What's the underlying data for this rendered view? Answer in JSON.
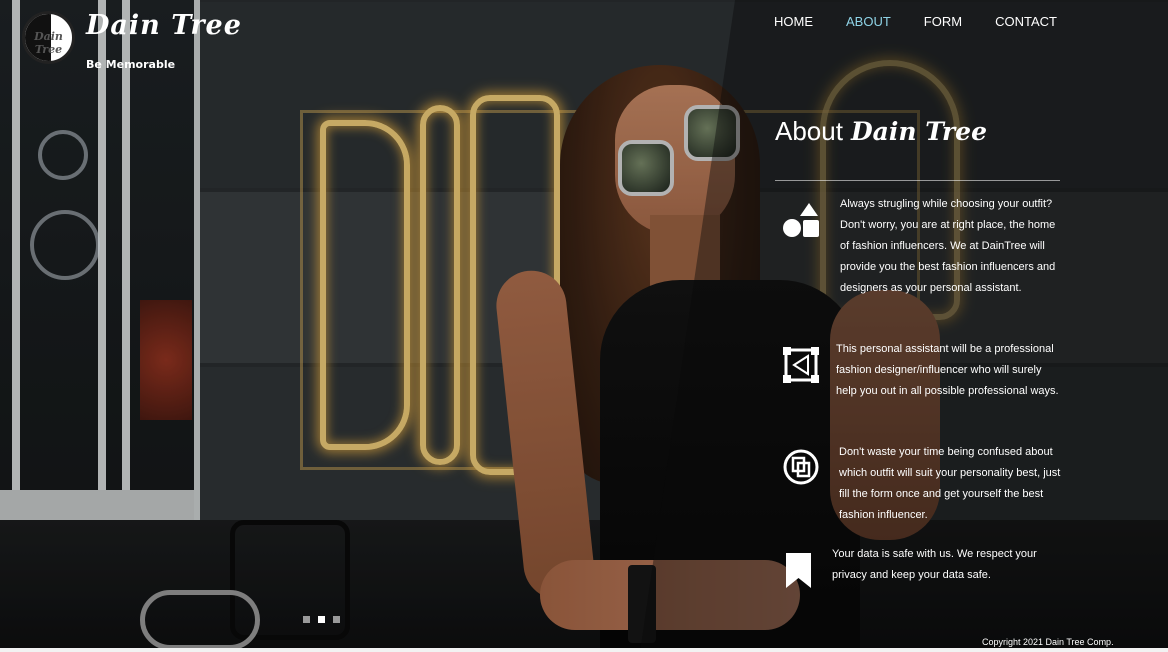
{
  "brand": {
    "name": "Dain Tree",
    "tagline": "Be Memorable",
    "logo_text": "Dain Tree"
  },
  "nav": {
    "items": [
      {
        "label": "HOME",
        "active": false
      },
      {
        "label": "ABOUT",
        "active": true
      },
      {
        "label": "FORM",
        "active": false
      },
      {
        "label": "CONTACT",
        "active": false
      }
    ],
    "active_color": "#8fd3e6"
  },
  "about": {
    "heading": "About",
    "heading_brand": "Dain Tree",
    "features": [
      {
        "icon": "shapes-icon",
        "text": "Always strugling while choosing your outfit? Don't worry, you are at right place, the home of fashion influencers. We at DainTree will provide you the best fashion influencers and designers as your personal assistant."
      },
      {
        "icon": "vector-nodes-icon",
        "text": "This personal assistant will be a professional fashion designer/influencer who will surely help you out in all possible professional ways."
      },
      {
        "icon": "copy-circle-icon",
        "text": "Don't waste your time being confused about which outfit will suit your personality best, just fill the form once and get yourself the best fashion influencer."
      },
      {
        "icon": "bookmark-icon",
        "text": "Your data is safe with us. We respect your privacy and keep your data safe."
      }
    ]
  },
  "background_sign": "DINER",
  "slider": {
    "count": 3,
    "active_index": 1
  },
  "footer": {
    "copyright": "Copyright 2021 Dain Tree Comp."
  }
}
